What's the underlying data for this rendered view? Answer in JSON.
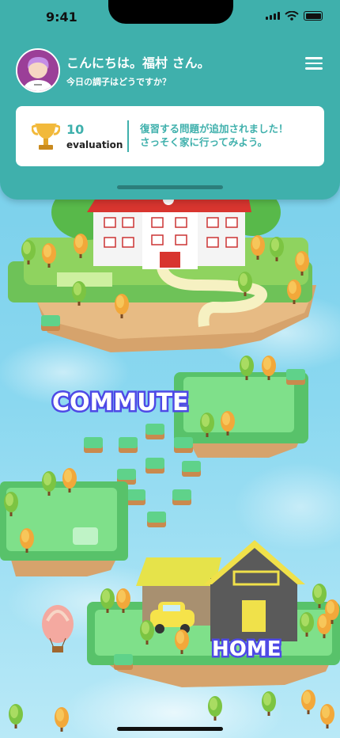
{
  "status_bar": {
    "time": "9:41"
  },
  "header": {
    "greeting": "こんにちは。福村 さん。",
    "subtitle": "今日の調子はどうですか？"
  },
  "info_card": {
    "score": "10",
    "score_label": "evaluation",
    "message_line1": "復習する問題が追加されました！",
    "message_line2": "さっそく家に行ってみよう。"
  },
  "map": {
    "commute_label": "COMMUTE",
    "home_label": "HOME"
  },
  "colors": {
    "header_bg": "#3fb0ac",
    "accent": "#3fb0ac",
    "label_fill": "#ffffff",
    "label_stroke": "#4e49e6"
  },
  "icons": [
    "menu-icon",
    "trophy-icon",
    "avatar-icon",
    "signal-icon",
    "wifi-icon",
    "battery-icon"
  ]
}
